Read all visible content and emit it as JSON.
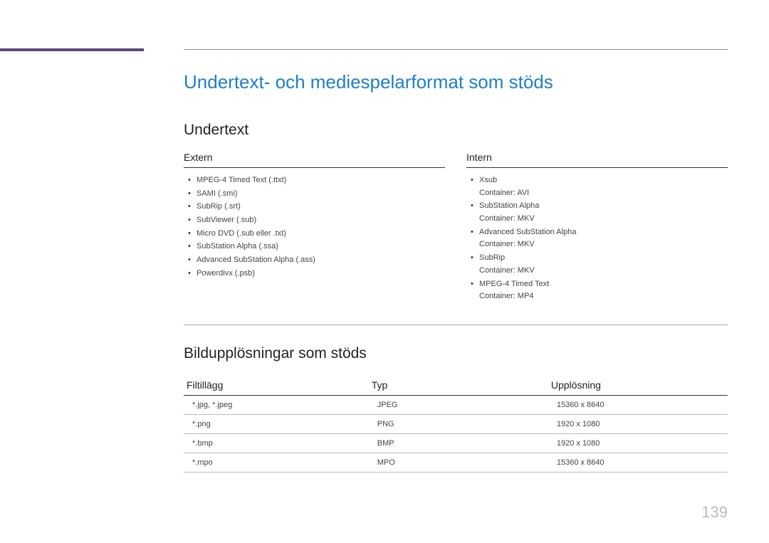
{
  "main_title": "Undertext- och mediespelarformat som stöds",
  "section1": {
    "title": "Undertext",
    "extern_label": "Extern",
    "intern_label": "Intern",
    "extern_items": [
      "MPEG-4 Timed Text (.ttxt)",
      "SAMI (.smi)",
      "SubRip (.srt)",
      "SubViewer (.sub)",
      "Micro DVD (.sub eller .txt)",
      "SubStation Alpha (.ssa)",
      "Advanced SubStation Alpha (.ass)",
      "Powerdivx (.psb)"
    ],
    "intern_items": [
      {
        "name": "Xsub",
        "container": "Container: AVI"
      },
      {
        "name": "SubStation Alpha",
        "container": "Container: MKV"
      },
      {
        "name": "Advanced SubStation Alpha",
        "container": "Container: MKV"
      },
      {
        "name": "SubRip",
        "container": "Container: MKV"
      },
      {
        "name": "MPEG-4 Timed Text",
        "container": "Container: MP4"
      }
    ]
  },
  "section2": {
    "title": "Bildupplösningar som stöds",
    "headers": {
      "ext": "Filtillägg",
      "type": "Typ",
      "res": "Upplösning"
    },
    "rows": [
      {
        "ext": "*.jpg, *.jpeg",
        "type": "JPEG",
        "res": "15360 x 8640"
      },
      {
        "ext": "*.png",
        "type": "PNG",
        "res": "1920 x 1080"
      },
      {
        "ext": "*.bmp",
        "type": "BMP",
        "res": "1920 x 1080"
      },
      {
        "ext": "*.mpo",
        "type": "MPO",
        "res": "15360 x 8640"
      }
    ]
  },
  "page_number": "139"
}
